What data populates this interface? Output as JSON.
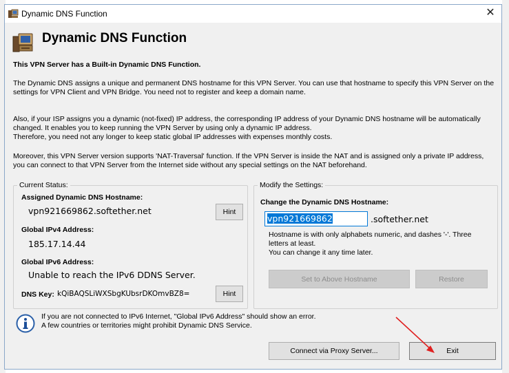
{
  "window": {
    "title": "Dynamic DNS Function",
    "close_glyph": "✕"
  },
  "header": {
    "title": "Dynamic DNS Function"
  },
  "intro": {
    "headline": "This VPN Server has a Built-in Dynamic DNS Function.",
    "p1": "The Dynamic DNS assigns a unique and permanent DNS hostname for this VPN Server. You can use that hostname to specify this VPN Server on the settings for VPN Client and VPN Bridge. You need not to register and keep a domain name.",
    "p2": "Also, if your ISP assigns you a dynamic (not-fixed) IP address, the corresponding IP address of your Dynamic DNS hostname will be automatically changed. It enables you to keep running the VPN Server by using only a dynamic IP address.",
    "p3": "Therefore, you need not any longer to keep static global IP addresses with expenses monthly costs.",
    "p4": "Moreover, this VPN Server version supports 'NAT-Traversal' function. If the VPN Server is inside the NAT and is assigned only a private IP address, you can connect to that VPN Server from the Internet side without any special settings on the NAT beforehand."
  },
  "status": {
    "legend": "Current Status:",
    "hostname_label": "Assigned Dynamic DNS Hostname:",
    "hostname_value": "vpn921669862.softether.net",
    "ipv4_label": "Global IPv4 Address:",
    "ipv4_value": "185.17.14.44",
    "ipv6_label": "Global IPv6 Address:",
    "ipv6_value": "Unable to reach the IPv6 DDNS Server.",
    "key_label": "DNS Key:",
    "key_value": "kQiBAQSLiWXSbgKUbsrDKOmvBZ8=",
    "hint_label": "Hint",
    "hint2_label": "Hint"
  },
  "modify": {
    "legend": "Modify the Settings:",
    "change_label": "Change the Dynamic DNS Hostname:",
    "input_value": "vpn921669862",
    "suffix": ".softether.net",
    "note1": "Hostname is with only alphabets numeric, and dashes '-'. Three letters at least.",
    "note2": "You can change it any time later.",
    "set_button": "Set to Above Hostname",
    "restore_button": "Restore"
  },
  "footer": {
    "info1": "If you are not connected to IPv6 Internet, \"Global IPv6 Address\" should show an error.",
    "info2": "A few countries or territories might prohibit Dynamic DNS Service.",
    "proxy_button": "Connect via Proxy Server...",
    "exit_button": "Exit"
  },
  "colors": {
    "window_bg": "#f0f0f0",
    "selection": "#0078d7",
    "arrow": "#e02020"
  }
}
